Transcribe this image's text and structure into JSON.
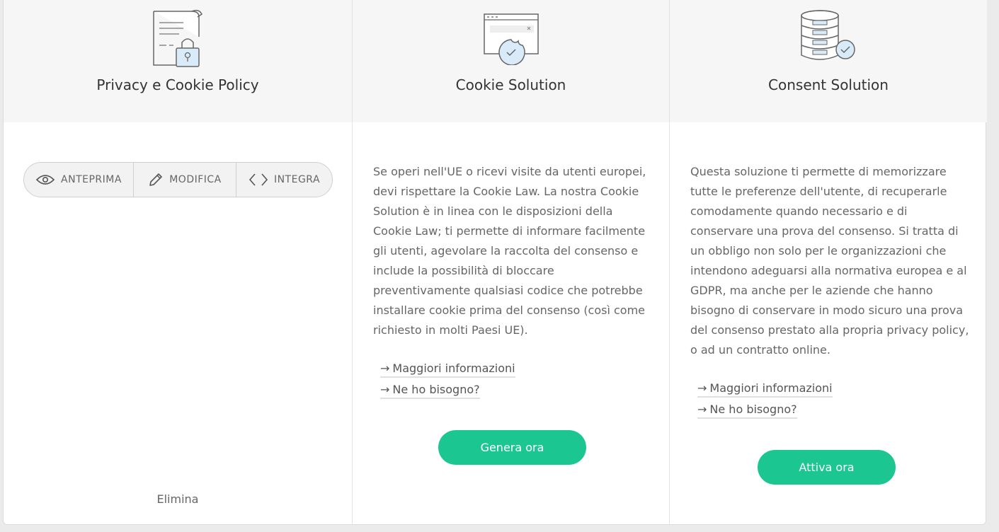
{
  "columns": [
    {
      "title": "Privacy e Cookie Policy",
      "icon": "document-lock-icon",
      "actions": {
        "preview": "ANTEPRIMA",
        "edit": "MODIFICA",
        "embed": "INTEGRA"
      },
      "delete_label": "Elimina"
    },
    {
      "title": "Cookie Solution",
      "icon": "browser-cookie-icon",
      "description": "Se operi nell'UE o ricevi visite da utenti europei, devi rispettare la Cookie Law. La nostra Cookie Solution è in linea con le disposizioni della Cookie Law; ti permette di informare facilmente gli utenti, agevolare la raccolta del consenso e include la possibilità di bloccare preventivamente qualsiasi codice che potrebbe installare cookie prima del consenso (così come richiesto in molti Paesi UE).",
      "links": [
        "Maggiori informazioni",
        "Ne ho bisogno?"
      ],
      "cta": "Genera ora"
    },
    {
      "title": "Consent Solution",
      "icon": "database-check-icon",
      "description": "Questa soluzione ti permette di memorizzare tutte le preferenze dell'utente, di recuperarle comodamente quando necessario e di conservare una prova del consenso. Si tratta di un obbligo non solo per le organizzazioni che intendono adeguarsi alla normativa europea e al GDPR, ma anche per le aziende che hanno bisogno di conservare in modo sicuro una prova del consenso prestato alla propria privacy policy, o ad un contratto online.",
      "links": [
        "Maggiori informazioni",
        "Ne ho bisogno?"
      ],
      "cta": "Attiva ora"
    }
  ],
  "colors": {
    "accent": "#1cc691",
    "header_bg": "#f6f6f6",
    "icon_fill": "#d9ebf9"
  }
}
